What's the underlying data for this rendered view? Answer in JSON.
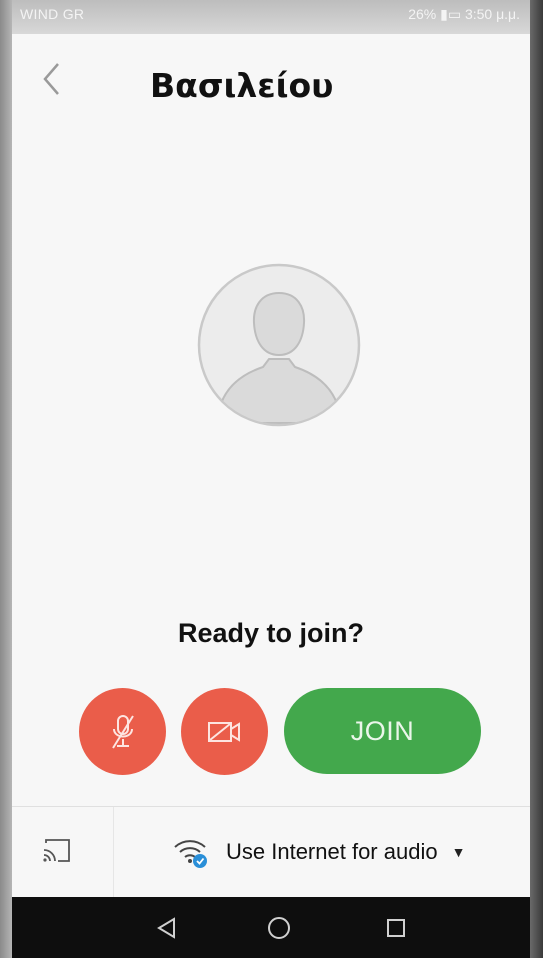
{
  "status": {
    "carrier": "WIND GR",
    "battery_time": "26% ▮▭ 3:50 μ.μ."
  },
  "header": {
    "title": "Βασιλείου"
  },
  "main": {
    "ready_text": "Ready to join?",
    "join_label": "JOIN"
  },
  "bottom": {
    "audio_label": "Use Internet for audio"
  },
  "icons": [
    "back-icon",
    "avatar-icon",
    "mic-off-icon",
    "video-off-icon",
    "cast-icon",
    "wifi-audio-icon",
    "dropdown-caret-icon",
    "nav-back-icon",
    "nav-home-icon",
    "nav-recents-icon"
  ],
  "colors": {
    "red_button": "#ea5d4a",
    "green_button": "#43a84c",
    "background": "#f7f7f7"
  }
}
